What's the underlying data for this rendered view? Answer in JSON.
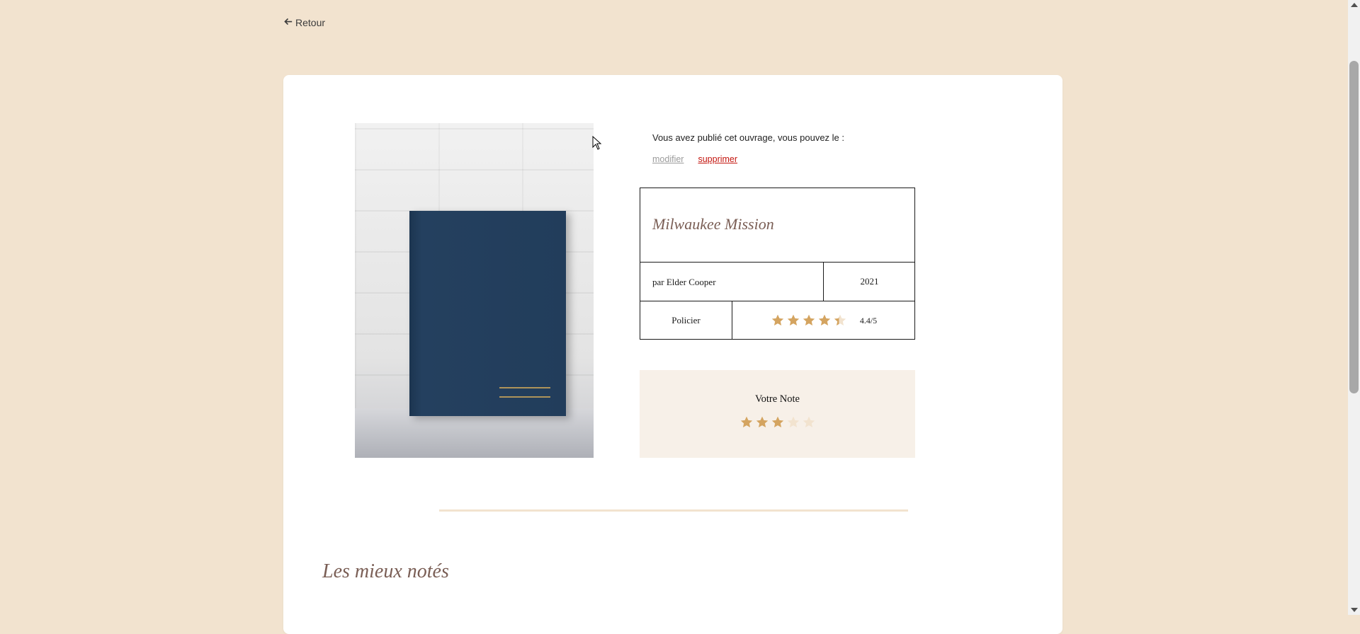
{
  "nav": {
    "back_label": "Retour"
  },
  "owner": {
    "notice": "Vous avez publié cet ouvrage, vous pouvez le :",
    "edit_label": "modifier",
    "delete_label": "supprimer"
  },
  "book": {
    "title": "Milwaukee Mission",
    "author": "par Elder Cooper",
    "year": "2021",
    "genre": "Policier",
    "average_rating": 4.4,
    "average_rating_label": "4.4/5"
  },
  "vote": {
    "title": "Votre Note",
    "user_rating": 3,
    "max": 5
  },
  "section": {
    "title": "Les mieux notés"
  },
  "colors": {
    "background": "#f2e3cf",
    "star_filled": "#d4a460",
    "star_empty": "#f2e3cf",
    "delete_link": "#c4160f",
    "title_color": "#7a5e55"
  },
  "icons": {
    "back": "arrow-left-icon",
    "star": "star-icon"
  }
}
